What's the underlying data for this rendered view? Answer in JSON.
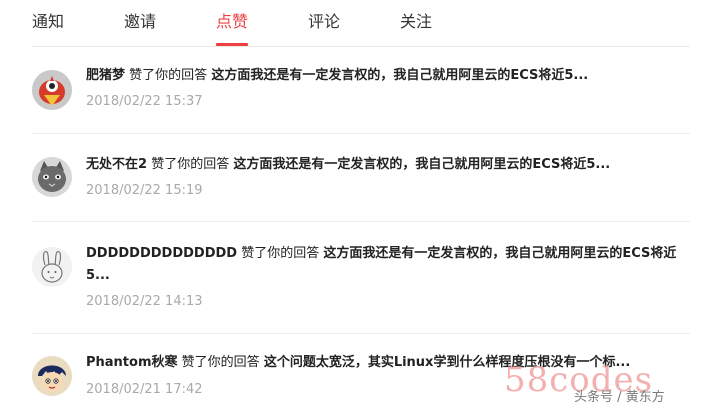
{
  "tabs": [
    {
      "label": "通知",
      "active": false
    },
    {
      "label": "邀请",
      "active": false
    },
    {
      "label": "点赞",
      "active": true
    },
    {
      "label": "评论",
      "active": false
    },
    {
      "label": "关注",
      "active": false
    }
  ],
  "notifications": [
    {
      "user": "肥猪梦",
      "action": "赞了你的回答",
      "snippet": "这方面我还是有一定发言权的，我自己就用阿里云的ECS将近5...",
      "time": "2018/02/22 15:37",
      "avatar": "bird-avatar"
    },
    {
      "user": "无处不在2",
      "action": "赞了你的回答",
      "snippet": "这方面我还是有一定发言权的，我自己就用阿里云的ECS将近5...",
      "time": "2018/02/22 15:19",
      "avatar": "cat-avatar"
    },
    {
      "user": "DDDDDDDDDDDDDD",
      "action": "赞了你的回答",
      "snippet": "这方面我还是有一定发言权的，我自己就用阿里云的ECS将近5...",
      "time": "2018/02/22 14:13",
      "avatar": "rabbit-sketch-avatar"
    },
    {
      "user": "Phantom秋寒",
      "action": "赞了你的回答",
      "snippet": "这个问题太宽泛，其实Linux学到什么样程度压根没有一个标...",
      "time": "2018/02/21 17:42",
      "avatar": "cartoon-boy-avatar"
    }
  ],
  "watermark": {
    "site": "58codes",
    "source": "头条号 / 黄东方"
  },
  "colors": {
    "accent": "#f04142",
    "time": "#a9a9a9",
    "divider": "#ececec"
  }
}
